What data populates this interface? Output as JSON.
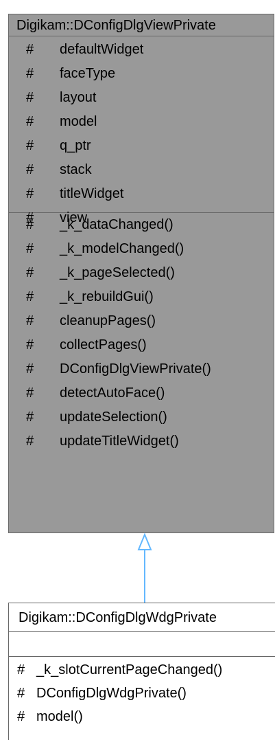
{
  "parent_class": {
    "name": "Digikam::DConfigDlgViewPrivate",
    "attributes": [
      {
        "visibility": "#",
        "name": "defaultWidget"
      },
      {
        "visibility": "#",
        "name": "faceType"
      },
      {
        "visibility": "#",
        "name": "layout"
      },
      {
        "visibility": "#",
        "name": "model"
      },
      {
        "visibility": "#",
        "name": "q_ptr"
      },
      {
        "visibility": "#",
        "name": "stack"
      },
      {
        "visibility": "#",
        "name": "titleWidget"
      },
      {
        "visibility": "#",
        "name": "view"
      }
    ],
    "methods": [
      {
        "visibility": "#",
        "name": "_k_dataChanged()"
      },
      {
        "visibility": "#",
        "name": "_k_modelChanged()"
      },
      {
        "visibility": "#",
        "name": "_k_pageSelected()"
      },
      {
        "visibility": "#",
        "name": "_k_rebuildGui()"
      },
      {
        "visibility": "#",
        "name": "cleanupPages()"
      },
      {
        "visibility": "#",
        "name": "collectPages()"
      },
      {
        "visibility": "#",
        "name": "DConfigDlgViewPrivate()"
      },
      {
        "visibility": "#",
        "name": "detectAutoFace()"
      },
      {
        "visibility": "#",
        "name": "updateSelection()"
      },
      {
        "visibility": "#",
        "name": "updateTitleWidget()"
      }
    ],
    "fill_color": "#999999",
    "border_color": "#666666"
  },
  "child_class": {
    "name": "Digikam::DConfigDlgWdgPrivate",
    "attributes": [],
    "methods": [
      {
        "visibility": "#",
        "name": "_k_slotCurrentPageChanged()"
      },
      {
        "visibility": "#",
        "name": "DConfigDlgWdgPrivate()"
      },
      {
        "visibility": "#",
        "name": "model()"
      }
    ],
    "fill_color": "#ffffff",
    "border_color": "#666666"
  },
  "relationship": {
    "type": "inheritance",
    "arrow_color": "#63b8ff"
  }
}
